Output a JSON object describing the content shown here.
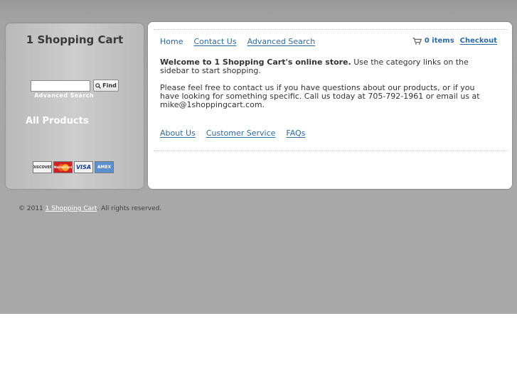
{
  "site": {
    "title": "1 Shopping Cart"
  },
  "sidebar": {
    "search": {
      "value": "",
      "button_label": "Find",
      "icon": "magnifier-icon"
    },
    "advanced_search_label": "Advanced Search",
    "category_link": "All Products",
    "payment_cards": [
      "DISCOVER",
      "MasterCard",
      "VISA",
      "AMEX"
    ]
  },
  "nav": {
    "links": [
      "Home",
      "Contact Us",
      "Advanced Search"
    ]
  },
  "cart": {
    "icon": "cart-icon",
    "count": "0 items",
    "checkout": "Checkout"
  },
  "content": {
    "welcome_bold": "Welcome to 1 Shopping Cart's online store.",
    "welcome_rest": " Use the category links on the sidebar to start shopping.",
    "contact_text": "Please feel free to contact us if you have questions about our products, or if you have looking for something specific. Call us today at 705-792-1961 or email us at mike@1shoppingcart.com."
  },
  "footer_links": [
    "About Us",
    "Customer Service",
    "FAQs"
  ],
  "footer": {
    "prefix": "© 2011 ",
    "link": "1 Shopping Cart",
    "suffix": ". All rights reserved."
  }
}
